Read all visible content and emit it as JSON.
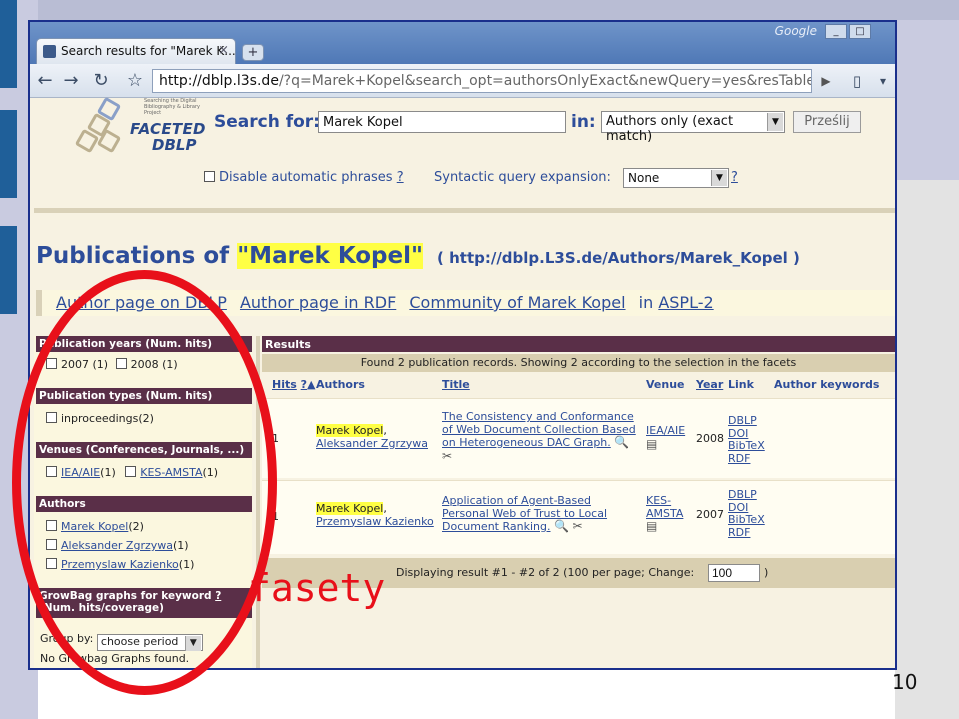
{
  "browser": {
    "tab_title": "Search results for \"Marek K...",
    "new_tab_symbol": "+",
    "brand": "Google",
    "window_controls": [
      "_",
      "□"
    ],
    "url_host": "http://dblp.l3s.de",
    "url_path": "/?q=Marek+Kopel&search_opt=authorsOnlyExact&newQuery=yes&resTableName=quer"
  },
  "logo": {
    "tagline": "Searching the Digital Bibliography & Library Project",
    "line1": "FACETED",
    "line2": "DBLP"
  },
  "search": {
    "label": "Search for:",
    "value": "Marek Kopel",
    "in_label": "in:",
    "in_value": "Authors only (exact match)",
    "submit": "Prześlij"
  },
  "options": {
    "disable_phrases": "Disable automatic phrases",
    "help": "?",
    "syntactic_label": "Syntactic query expansion:",
    "syntactic_value": "None"
  },
  "heading": {
    "prefix": "Publications of",
    "name": "\"Marek Kopel\"",
    "url": "( http://dblp.L3S.de/Authors/Marek_Kopel )"
  },
  "author_links": {
    "page_dblp": "Author page on DBLP",
    "page_rdf": "Author page in RDF",
    "community": "Community of Marek Kopel",
    "in_text": "in",
    "aspl": "ASPL-2"
  },
  "facets": {
    "years": {
      "title": "Publication years (Num. hits)",
      "items": [
        "2007 (1)",
        "2008 (1)"
      ]
    },
    "types": {
      "title": "Publication types (Num. hits)",
      "items": [
        "inproceedings(2)"
      ]
    },
    "venues": {
      "title": "Venues (Conferences, Journals, ...)",
      "items": [
        {
          "name": "IEA/AIE",
          "count": "(1)"
        },
        {
          "name": "KES-AMSTA",
          "count": "(1)"
        }
      ]
    },
    "authors": {
      "title": "Authors",
      "items": [
        {
          "name": "Marek Kopel",
          "count": "(2)"
        },
        {
          "name": "Aleksander Zgrzywa",
          "count": "(1)"
        },
        {
          "name": "Przemyslaw Kazienko",
          "count": "(1)"
        }
      ]
    },
    "growbag": {
      "title_line1": "GrowBag graphs for keyword",
      "help": "?",
      "title_line2": "(Num. hits/coverage)",
      "group_by": "Group by:",
      "group_value": "choose period",
      "empty": "No Growbag Graphs found."
    }
  },
  "results": {
    "header": "Results",
    "found": "Found 2 publication records. Showing 2 according to the selection in the facets",
    "columns": {
      "hits": "Hits",
      "help": "?",
      "sort": "▲",
      "authors": "Authors",
      "title": "Title",
      "venue": "Venue",
      "year": "Year",
      "link": "Link",
      "keywords": "Author keywords"
    },
    "rows": [
      {
        "num": "1",
        "author1": "Marek Kopel",
        "author2": "Aleksander Zgrzywa",
        "title_l1": "The Consistency and Conformance",
        "title_l2": "of Web Document Collection Based",
        "title_l3": "on Heterogeneous DAC Graph.",
        "venue_l1": "IEA/AIE",
        "venue_l2": "",
        "year": "2008",
        "links": [
          "DBLP",
          "DOI",
          "BibTeX",
          "RDF"
        ]
      },
      {
        "num": "1",
        "author1": "Marek Kopel",
        "author2": "Przemyslaw Kazienko",
        "title_l1": "Application of Agent-Based",
        "title_l2": "Personal Web of Trust to Local",
        "title_l3": "Document Ranking.",
        "venue_l1": "KES-",
        "venue_l2": "AMSTA",
        "year": "2007",
        "links": [
          "DBLP",
          "DOI",
          "BibTeX",
          "RDF"
        ]
      }
    ],
    "footer_text": "Displaying result #1 - #2 of 2 (100 per page; Change:",
    "per_page": "100",
    "footer_close": ")"
  },
  "annotation": "fasety",
  "slide_number": "10",
  "colors": {
    "facet_header": "#5a2f48",
    "link": "#2d4d9a",
    "highlight": "#ffff44",
    "annotation": "#e8101a"
  }
}
